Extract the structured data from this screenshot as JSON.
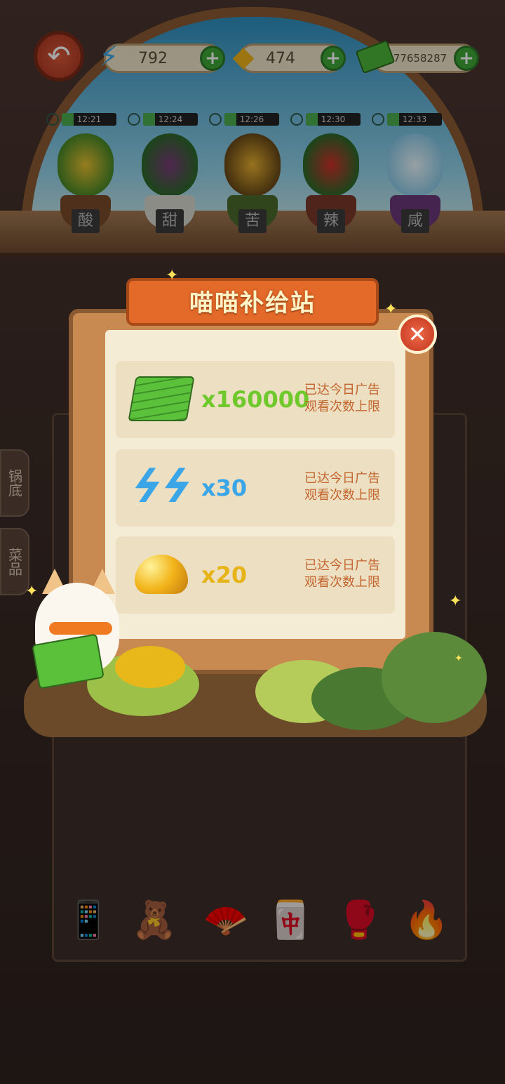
{
  "hud": {
    "energy": "792",
    "gems": "474",
    "cash": "77658287"
  },
  "timers": [
    "12:21",
    "12:24",
    "12:26",
    "12:30",
    "12:33"
  ],
  "plants": [
    {
      "name": "酸",
      "color": "#e0b020"
    },
    {
      "name": "甜",
      "color": "#8a3a8a"
    },
    {
      "name": "苦",
      "color": "#c89a2a"
    },
    {
      "name": "辣",
      "color": "#d0302a"
    },
    {
      "name": "咸",
      "color": "#a8dcf0"
    }
  ],
  "side_tabs": [
    "锅底",
    "菜品"
  ],
  "modal": {
    "title": "喵喵补给站",
    "rewards": [
      {
        "icon": "cash-stack-icon",
        "amount": "x160000",
        "amount_color": "#6fc82c",
        "status": [
          "已达今日广告",
          "观看次数上限"
        ]
      },
      {
        "icon": "energy-bolt-icon",
        "amount": "x30",
        "amount_color": "#3aa6e8",
        "status": [
          "已达今日广告",
          "观看次数上限"
        ]
      },
      {
        "icon": "gold-gem-icon",
        "amount": "x20",
        "amount_color": "#e6b419",
        "status": [
          "已达今日广告",
          "观看次数上限"
        ]
      }
    ]
  },
  "tools": [
    "phone-icon",
    "plush-doll-icon",
    "folding-fan-icon",
    "mahjong-tile-icon",
    "boxing-glove-icon",
    "lighter-icon"
  ]
}
